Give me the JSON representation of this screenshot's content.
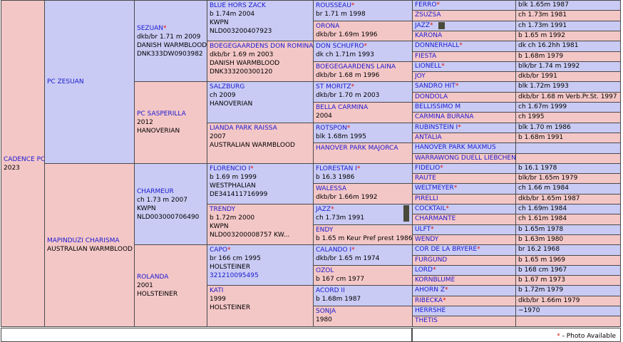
{
  "gen1": [
    {
      "name": "CADENCE PC",
      "star": false,
      "lines": [
        "2023"
      ]
    }
  ],
  "gen2": [
    {
      "name": "PC ZESUAN",
      "star": false,
      "lines": []
    },
    {
      "name": "MAPINDUZI CHARISMA",
      "star": false,
      "lines": [
        "AUSTRALIAN WARMBLOOD"
      ]
    }
  ],
  "gen3": [
    {
      "name": "SEZUAN",
      "star": true,
      "lines": [
        "dkb/br 1.71 m 2009",
        "DANISH WARMBLOOD",
        "DNK333DW0903982"
      ]
    },
    {
      "name": "PC SASPERILLA",
      "star": false,
      "lines": [
        "2012",
        "HANOVERIAN"
      ]
    },
    {
      "name": "CHARMEUR",
      "star": false,
      "lines": [
        "ch 1.73 m 2007",
        "KWPN",
        "NLD003000706490"
      ]
    },
    {
      "name": "ROLANDA",
      "star": false,
      "lines": [
        "2001",
        "HOLSTEINER"
      ]
    }
  ],
  "gen4": [
    {
      "name": "BLUE HORS ZACK",
      "star": false,
      "lines": [
        "b 1.74m 2004",
        "KWPN",
        "NLD003200407923"
      ]
    },
    {
      "name": "BOEGEGAARDENS DON ROMINA",
      "star": false,
      "lines": [
        "dkb/br 1.69 m 2003",
        "DANISH WARMBLOOD",
        "DNK333200300120"
      ]
    },
    {
      "name": "SALZBURG",
      "star": false,
      "lines": [
        "ch 2009",
        "HANOVERIAN"
      ]
    },
    {
      "name": "LIANDA PARK RAISSA",
      "star": false,
      "lines": [
        "2007",
        "AUSTRALIAN WARMBLOOD"
      ]
    },
    {
      "name": "FLORENCIO I",
      "star": true,
      "lines": [
        "b 1.69 m 1999",
        "WESTPHALIAN",
        "DE341411716999"
      ]
    },
    {
      "name": "TRENDY",
      "star": false,
      "lines": [
        "b 1.72m 2000",
        "KWPN",
        "NLD003200008757 KW..."
      ]
    },
    {
      "name": "CAPO",
      "star": true,
      "lines": [
        "br 166 cm 1995",
        "HOLSTEINER"
      ],
      "link": "321210095495"
    },
    {
      "name": "KATI",
      "star": false,
      "lines": [
        "1999",
        "HOLSTEINER"
      ]
    }
  ],
  "gen5": [
    {
      "name": "ROUSSEAU",
      "star": true,
      "lines": [
        "br 1.71 m 1998"
      ]
    },
    {
      "name": "ORONA",
      "star": false,
      "lines": [
        "dkb/br 1.69m 1996"
      ]
    },
    {
      "name": "DON SCHUFRO",
      "star": true,
      "lines": [
        "dk ch 1.71m 1993"
      ]
    },
    {
      "name": "BOEGEGAARDENS LAINA",
      "star": false,
      "lines": [
        "dkb/br 1.68 m 1996"
      ]
    },
    {
      "name": "ST MORITZ",
      "star": true,
      "lines": [
        "dkb/br 1.70 m 2003"
      ]
    },
    {
      "name": "BELLA CARMINA",
      "star": false,
      "lines": [
        "2004"
      ]
    },
    {
      "name": "ROTSPON",
      "star": true,
      "lines": [
        "blk 1.68m 1995"
      ]
    },
    {
      "name": "HANOVER PARK MAJORCA",
      "star": false,
      "lines": []
    },
    {
      "name": "FLORESTAN I",
      "star": true,
      "lines": [
        "b 16.3 1986"
      ]
    },
    {
      "name": "WALESSA",
      "star": false,
      "lines": [
        "dkb/br 1.66m 1992"
      ]
    },
    {
      "name": "JAZZ",
      "star": true,
      "lines": [
        "ch 1.73m 1991"
      ]
    },
    {
      "name": "ENDY",
      "star": false,
      "lines": [
        "b 1.65 m Keur Pref prest 1986"
      ]
    },
    {
      "name": "CALANDO I",
      "star": true,
      "lines": [
        "dkb/br 1.65 m 1974"
      ]
    },
    {
      "name": "OZOL",
      "star": false,
      "lines": [
        "b 167 cm 1977"
      ]
    },
    {
      "name": "ACORD II",
      "star": false,
      "lines": [
        "b 1.68m 1987"
      ]
    },
    {
      "name": "SONJA",
      "star": false,
      "lines": [
        "1980"
      ]
    }
  ],
  "gen6": [
    {
      "name": "FERRO",
      "star": true,
      "info": "blk 1.65m 1987"
    },
    {
      "name": "ZSUZSA",
      "star": false,
      "info": "ch 1.73m 1981"
    },
    {
      "name": "JAZZ",
      "star": true,
      "info": "ch 1.73m 1991"
    },
    {
      "name": "KARONA",
      "star": false,
      "info": "b 1.65 m 1992"
    },
    {
      "name": "DONNERHALL",
      "star": true,
      "info": "dk ch 16.2hh 1981"
    },
    {
      "name": "FIESTA",
      "star": false,
      "info": "b 1.68m 1979"
    },
    {
      "name": "LIONELL",
      "star": true,
      "info": "blk/br 1.74 m 1992"
    },
    {
      "name": "JOY",
      "star": false,
      "info": "dkb/br 1991"
    },
    {
      "name": "SANDRO HIT",
      "star": true,
      "info": "blk 1.72m 1993"
    },
    {
      "name": "DONDOLA",
      "star": false,
      "info": "dkb/br 1.68 m Verb.Pr.St. 1997"
    },
    {
      "name": "BELLISSIMO M",
      "star": false,
      "info": "ch 1.67m 1999"
    },
    {
      "name": "CARMINA BURANA",
      "star": false,
      "info": "ch 1995"
    },
    {
      "name": "RUBINSTEIN I",
      "star": true,
      "info": "blk 1.70 m 1986"
    },
    {
      "name": "ANTALIA",
      "star": false,
      "info": "b 1.68m 1991"
    },
    {
      "name": "HANOVER PARK MAXMUS",
      "star": false,
      "info": ""
    },
    {
      "name": "WARRAWONG DUELL LIEBCHEN",
      "star": false,
      "info": ""
    },
    {
      "name": "FIDELIO",
      "star": true,
      "info": "b 16.1 1978"
    },
    {
      "name": "RAUTE",
      "star": false,
      "info": "blk/br 1.65m 1979"
    },
    {
      "name": "WELTMEYER",
      "star": true,
      "info": "ch 1.66 m 1984"
    },
    {
      "name": "PIRELLI",
      "star": false,
      "info": "dkb/br 1.65m 1987"
    },
    {
      "name": "COCKTAIL",
      "star": true,
      "info": "ch 1.69m 1984"
    },
    {
      "name": "CHARMANTE",
      "star": false,
      "info": "ch 1.61m 1984"
    },
    {
      "name": "ULFT",
      "star": true,
      "info": "b 1.65m 1978"
    },
    {
      "name": "WENDY",
      "star": false,
      "info": "b 1.63m 1980"
    },
    {
      "name": "COR DE LA BRYERE",
      "star": true,
      "info": "br 16.2 1968"
    },
    {
      "name": "FURGUND",
      "star": false,
      "info": "b 1.65 m 1969"
    },
    {
      "name": "LORD",
      "star": true,
      "info": "b 168 cm 1967"
    },
    {
      "name": "KORNBLUME",
      "star": false,
      "info": "b 1.67 m 1973"
    },
    {
      "name": "AHORN Z",
      "star": true,
      "info": "b 1.72m 1979"
    },
    {
      "name": "RIBECKA",
      "star": true,
      "info": "dkb/br 1.66m 1979"
    },
    {
      "name": "HERRSHE",
      "star": false,
      "info": "~1970"
    },
    {
      "name": "THETIS",
      "star": false,
      "info": ""
    }
  ],
  "legend": {
    "star": "*",
    "text": "- Photo Available"
  },
  "colors": {
    "male_bg": "#c9cbf4",
    "female_bg": "#f4c7c7",
    "name_link": "#1a1ad0",
    "photo_star": "#e01010"
  }
}
